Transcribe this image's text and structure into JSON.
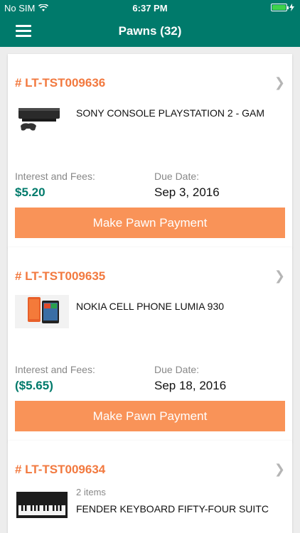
{
  "status_bar": {
    "carrier": "No SIM",
    "time": "6:37 PM",
    "battery_level": 1.0
  },
  "header": {
    "title": "Pawns (32)"
  },
  "pawns": [
    {
      "id": "# LT-TST009636",
      "item_name": "SONY CONSOLE PLAYSTATION 2 - GAM",
      "fees_label": "Interest and Fees:",
      "fees_value": "$5.20",
      "due_label": "Due Date:",
      "due_value": "Sep 3, 2016",
      "button_label": "Make Pawn Payment"
    },
    {
      "id": "# LT-TST009635",
      "item_name": "NOKIA CELL PHONE LUMIA 930",
      "fees_label": "Interest and Fees:",
      "fees_value": "($5.65)",
      "due_label": "Due Date:",
      "due_value": "Sep 18, 2016",
      "button_label": "Make Pawn Payment"
    },
    {
      "id": "# LT-TST009634",
      "item_count": "2 items",
      "item_name": "FENDER KEYBOARD FIFTY-FOUR SUITC"
    }
  ],
  "colors": {
    "brand": "#007a6b",
    "accent": "#f2793f",
    "button": "#f99358",
    "background": "#ededed"
  },
  "icons": [
    "wifi-icon",
    "battery-icon",
    "charging-icon",
    "menu-icon",
    "chevron-right-icon"
  ]
}
